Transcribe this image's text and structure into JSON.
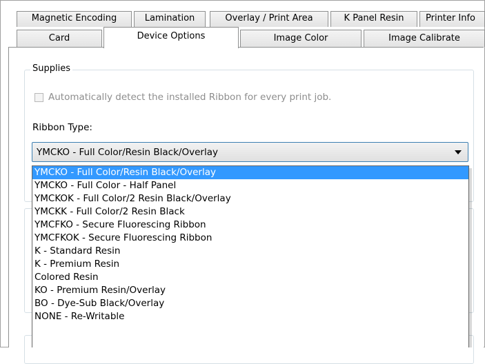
{
  "tabs_row1": [
    {
      "label": "Magnetic Encoding"
    },
    {
      "label": "Lamination"
    },
    {
      "label": "Overlay / Print Area"
    },
    {
      "label": "K Panel Resin"
    },
    {
      "label": "Printer Info"
    }
  ],
  "tabs_row2": [
    {
      "label": "Card"
    },
    {
      "label": "Device Options",
      "active": true
    },
    {
      "label": "Image Color"
    },
    {
      "label": "Image Calibrate"
    }
  ],
  "supplies": {
    "legend": "Supplies",
    "auto_detect_label": "Automatically detect the installed Ribbon for every print job.",
    "auto_detect_checked": false,
    "auto_detect_enabled": false,
    "ribbon_type_label": "Ribbon Type:",
    "ribbon_type_value": "YMCKO - Full Color/Resin Black/Overlay"
  },
  "ribbon_options": [
    "YMCKO - Full Color/Resin Black/Overlay",
    "YMCKO - Full Color - Half Panel",
    "YMCKOK - Full Color/2 Resin Black/Overlay",
    "YMCKK - Full Color/2 Resin Black",
    "YMCFKO - Secure Fluorescing Ribbon",
    "YMCFKOK - Secure Fluorescing Ribbon",
    "K - Standard Resin",
    "K - Premium Resin",
    "Colored Resin",
    "KO - Premium Resin/Overlay",
    "BO - Dye-Sub Black/Overlay",
    "NONE - Re-Writable"
  ],
  "selected_index": 0,
  "colors": {
    "selection": "#3399ff",
    "combo_border": "#3c7fb1",
    "tab_border": "#8e8f8f",
    "disabled_text": "#8d8d8d"
  }
}
